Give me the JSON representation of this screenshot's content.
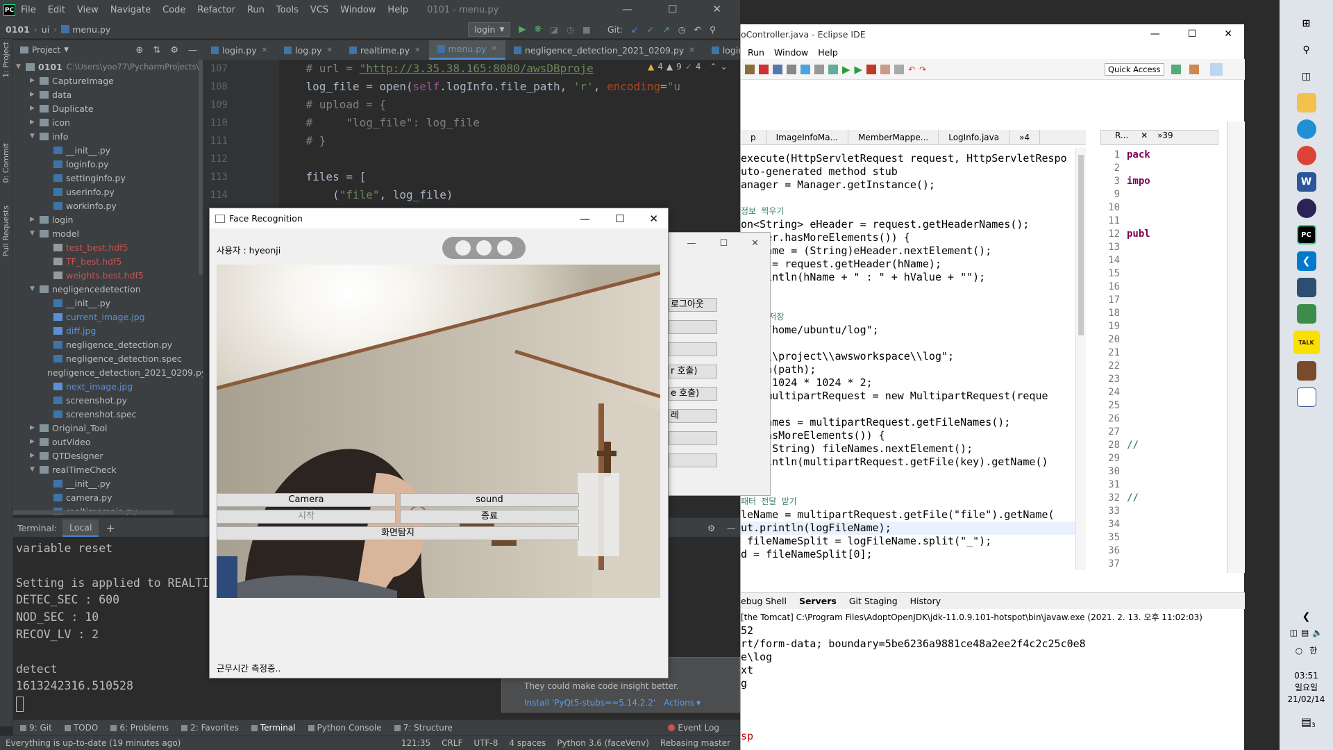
{
  "ide": {
    "menu": [
      "File",
      "Edit",
      "View",
      "Navigate",
      "Code",
      "Refactor",
      "Run",
      "Tools",
      "VCS",
      "Window",
      "Help"
    ],
    "title": "0101 - menu.py",
    "breadcrumb": [
      "0101",
      "ui",
      "menu.py"
    ],
    "run_config": "login",
    "git_label": "Git:",
    "tabs": [
      "login.py",
      "log.py",
      "realtime.py",
      "menu.py",
      "negligence_detection_2021_0209.py",
      "logincheck.py"
    ],
    "active_tab": 3,
    "project_label": "Project",
    "side_labels": [
      "1: Project",
      "0: Commit",
      "Pull Requests"
    ],
    "tree": [
      {
        "d": 0,
        "t": "0101",
        "x": "C:\\Users\\yoo77\\PycharmProjects\\",
        "k": "root",
        "o": true
      },
      {
        "d": 1,
        "t": "CaptureImage",
        "k": "dir"
      },
      {
        "d": 1,
        "t": "data",
        "k": "dir"
      },
      {
        "d": 1,
        "t": "Duplicate",
        "k": "dir"
      },
      {
        "d": 1,
        "t": "icon",
        "k": "dir"
      },
      {
        "d": 1,
        "t": "info",
        "k": "dir",
        "o": true
      },
      {
        "d": 2,
        "t": "__init__.py",
        "k": "py"
      },
      {
        "d": 2,
        "t": "loginfo.py",
        "k": "py"
      },
      {
        "d": 2,
        "t": "settinginfo.py",
        "k": "py"
      },
      {
        "d": 2,
        "t": "userinfo.py",
        "k": "py"
      },
      {
        "d": 2,
        "t": "workinfo.py",
        "k": "py"
      },
      {
        "d": 1,
        "t": "login",
        "k": "dir"
      },
      {
        "d": 1,
        "t": "model",
        "k": "dir",
        "o": true
      },
      {
        "d": 2,
        "t": "test_best.hdf5",
        "k": "red"
      },
      {
        "d": 2,
        "t": "TF_best.hdf5",
        "k": "red"
      },
      {
        "d": 2,
        "t": "weights.best.hdf5",
        "k": "red"
      },
      {
        "d": 1,
        "t": "negligencedetection",
        "k": "dir",
        "o": true
      },
      {
        "d": 2,
        "t": "__init__.py",
        "k": "py"
      },
      {
        "d": 2,
        "t": "current_image.jpg",
        "k": "blue"
      },
      {
        "d": 2,
        "t": "diff.jpg",
        "k": "blue"
      },
      {
        "d": 2,
        "t": "negligence_detection.py",
        "k": "py"
      },
      {
        "d": 2,
        "t": "negligence_detection.spec",
        "k": "py"
      },
      {
        "d": 2,
        "t": "negligence_detection_2021_0209.py",
        "k": "py"
      },
      {
        "d": 2,
        "t": "next_image.jpg",
        "k": "blue"
      },
      {
        "d": 2,
        "t": "screenshot.py",
        "k": "py"
      },
      {
        "d": 2,
        "t": "screenshot.spec",
        "k": "py"
      },
      {
        "d": 1,
        "t": "Original_Tool",
        "k": "dir"
      },
      {
        "d": 1,
        "t": "outVideo",
        "k": "dir"
      },
      {
        "d": 1,
        "t": "QTDesigner",
        "k": "dir"
      },
      {
        "d": 1,
        "t": "realTimeCheck",
        "k": "dir",
        "o": true
      },
      {
        "d": 2,
        "t": "__init__.py",
        "k": "py"
      },
      {
        "d": 2,
        "t": "camera.py",
        "k": "py"
      },
      {
        "d": 2,
        "t": "realtimemain.py",
        "k": "py"
      }
    ],
    "line_numbers": [
      "107",
      "108",
      "109",
      "110",
      "111",
      "112",
      "113",
      "114"
    ],
    "code_lines": [
      [
        [
          "    ",
          "p"
        ],
        [
          "# url = ",
          "c"
        ],
        [
          "\"http://3.35.38.165:8080/awsDBproje",
          "s"
        ]
      ],
      [
        [
          "    log_file = ",
          "p"
        ],
        [
          "open",
          "p"
        ],
        [
          "(",
          "p"
        ],
        [
          "self",
          "k"
        ],
        [
          ".logInfo.file_path, ",
          "p"
        ],
        [
          "'r'",
          "s"
        ],
        [
          ", ",
          "p"
        ],
        [
          "encoding",
          "n"
        ],
        [
          "=",
          "p"
        ],
        [
          "\"u",
          "s"
        ]
      ],
      [
        [
          "    ",
          "p"
        ],
        [
          "# upload = {",
          "c"
        ]
      ],
      [
        [
          "    ",
          "p"
        ],
        [
          "#     \"log_file\": log_file",
          "c"
        ]
      ],
      [
        [
          "    ",
          "p"
        ],
        [
          "# }",
          "c"
        ]
      ],
      [
        [
          "",
          "p"
        ]
      ],
      [
        [
          "    files = [",
          "p"
        ]
      ],
      [
        [
          "        (",
          "p"
        ],
        [
          "\"file\"",
          "s"
        ],
        [
          ", log_file)",
          "p"
        ]
      ]
    ],
    "inspections": [
      "4",
      "9",
      "4"
    ],
    "terminal_label": "Terminal:",
    "terminal_tab": "Local",
    "terminal_lines": [
      "variable reset",
      "",
      "Setting is applied to REALTI",
      "DETEC_SEC : 600",
      "NOD_SEC : 10",
      "RECOV_LV : 2",
      "",
      "detect",
      "1613242316.510528"
    ],
    "notice_text": "They could make code insight better.",
    "notice_link": "Install 'PyQt5-stubs==5.14.2.2'",
    "notice_actions": "Actions",
    "bottom_tools": [
      "9: Git",
      "TODO",
      "6: Problems",
      "2: Favorites",
      "Terminal",
      "Python Console",
      "7: Structure"
    ],
    "event_log": "Event Log",
    "status_left": "Everything is up-to-date (19 minutes ago)",
    "status_right": [
      "121:35",
      "CRLF",
      "UTF-8",
      "4 spaces",
      "Python 3.6 (faceVenv)",
      "Rebasing master"
    ]
  },
  "eclipse": {
    "title": "oController.java - Eclipse IDE",
    "menu": [
      "Run",
      "Window",
      "Help"
    ],
    "quick_access": "Quick Access",
    "tabs": [
      "p",
      "ImageInfoMa...",
      "MemberMappe...",
      "LogInfo.java",
      "»4"
    ],
    "outline_tab": "R...",
    "outline_more": "»39",
    "code_lines": [
      "execute(HttpServletRequest request, HttpServletRespo",
      "uto-generated method stub",
      "anager = Manager.getInstance();",
      "",
      "정보 찍우기",
      "on<String> eHeader = request.getHeaderNames();",
      "Header.hasMoreElements()) {",
      "g hName = (String)eHeader.nextElement();",
      "alue = request.getHeader(hName);",
      "t.println(hName + \" : \" + hValue + \"\");",
      "",
      "",
      "서버에 저장",
      " = \"/home/ubuntu/log\";",
      "",
      " \"C:\\\\project\\\\awsworkspace\\\\log\";",
      "intln(path);",
      "ze = 1024 * 1024 * 2;",
      "est multipartRequest = new MultipartRequest(reque",
      "",
      "ileNames = multipartRequest.getFileNames();",
      "es.hasMoreElements()) {",
      "y = (String) fileNames.nextElement();",
      "t.println(multipartRequest.getFile(key).getName()",
      "",
      "",
      "패터 전달 받기",
      "leName = multipartRequest.getFile(\"file\").getName(",
      "ut.println(logFileName);",
      " fileNameSplit = logFileName.split(\"_\");",
      "d = fileNameSplit[0];"
    ],
    "right_lines": [
      "1",
      "2",
      "3",
      "9",
      "10",
      "11",
      "12",
      "13",
      "14",
      "15",
      "16",
      "17",
      "18",
      "19",
      "20",
      "21",
      "22",
      "23",
      "24",
      "25",
      "26",
      "27",
      "28",
      "29",
      "30",
      "31",
      "32",
      "33",
      "34",
      "35",
      "36",
      "37",
      "38"
    ],
    "right_code": {
      "1": "pack",
      "3": "impo",
      "12": "publ",
      "28": "//",
      "32": "//"
    },
    "console_tabs": [
      "ebug Shell",
      "Servers",
      "Git Staging",
      "History"
    ],
    "console_header": "[the Tomcat] C:\\Program Files\\AdoptOpenJDK\\jdk-11.0.9.101-hotspot\\bin\\javaw.exe (2021. 2. 13. 오후 11:02:03)",
    "console_lines": [
      "52",
      "rt/form-data; boundary=5be6236a9881ce48a2ee2f4c2c25c0e8",
      "e\\log",
      "xt",
      "g",
      "",
      "",
      "",
      "sp",
      "",
      "sp"
    ]
  },
  "bg_window": {
    "buttons": [
      "로그아웃",
      "",
      "",
      "r 호출)",
      "e 호출)",
      "레",
      "",
      ""
    ]
  },
  "face_window": {
    "title": "Face Recognition",
    "user_label": "사용자 : hyeonji",
    "buttons": {
      "camera": "Camera",
      "sound": "sound",
      "start": "시작",
      "end": "종료",
      "screen": "화면탐지"
    },
    "status": "근무시간 측정중.."
  },
  "taskbar": {
    "time": "03:51",
    "day": "일요일",
    "date": "21/02/14",
    "ime": "한",
    "notif_count": "3",
    "kakao": "TALK"
  },
  "colors": {
    "ide_bg": "#2b2b2b",
    "ide_panel": "#3c3f41",
    "accent": "#4a88c7",
    "string": "#6a8759",
    "comment": "#808080",
    "keyword": "#cc7832",
    "self": "#94558d",
    "red_file": "#c75450",
    "blue_file": "#5c8fd6"
  }
}
